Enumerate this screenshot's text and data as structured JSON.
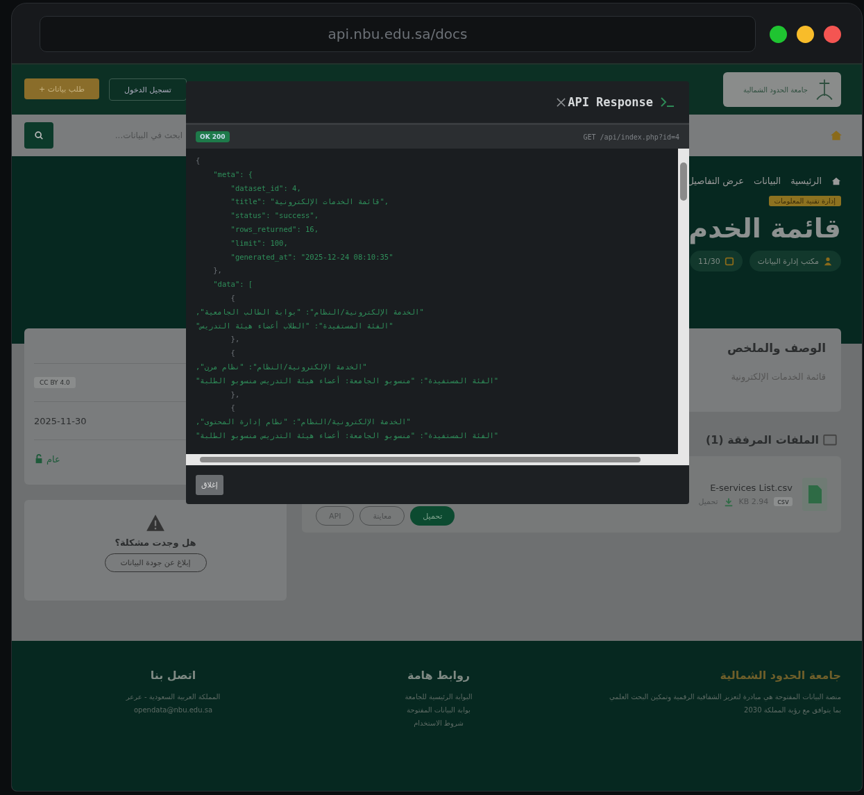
{
  "browser": {
    "address": "api.nbu.edu.sa/docs"
  },
  "header": {
    "logo_text": "جامعة الحدود الشمالية",
    "request_button": "طلب بيانات +",
    "login_button": "تسجيل الدخول"
  },
  "search": {
    "placeholder": "ابحث في البيانات..."
  },
  "breadcrumb": [
    "الرئيسية",
    "البيانات",
    "عرض التفاصيل"
  ],
  "hero": {
    "badge": "إدارة تقنية المعلومات",
    "title": "قائمة الخدم",
    "chips": [
      {
        "kind": "owner",
        "text": "مكتب إدارة البيانات"
      },
      {
        "kind": "date",
        "text": "11/30"
      }
    ]
  },
  "description": {
    "title": "الوصف والملخص",
    "text": "قائمة الخدمات الإلكترونية"
  },
  "files": {
    "title": "الملفات المرفقة (1)",
    "items": [
      {
        "name": "E-services List.csv",
        "format": "csv",
        "size": "2.94 KB",
        "downloads": "تحميل"
      }
    ],
    "actions": [
      {
        "kind": "primary",
        "label": "تحميل"
      },
      {
        "kind": "outline",
        "label": "معاينة"
      },
      {
        "kind": "outline",
        "label": "API"
      }
    ]
  },
  "meta_rows": [
    {
      "kind": "badge",
      "text": "CC BY 4.0"
    },
    {
      "kind": "plain",
      "text": "2025-11-30"
    },
    {
      "kind": "access",
      "text": "عام"
    }
  ],
  "problem": {
    "title": "هل وجدت مشكلة؟",
    "button": "إبلاغ عن جودة البيانات"
  },
  "footer": {
    "columns": [
      {
        "title": "جامعة الحدود الشمالية",
        "kind": "about",
        "lines": [
          "منصة البيانات المفتوحة هي مبادرة لتعزيز الشفافية الرقمية وتمكين البحث العلمي",
          "بما يتوافق مع رؤية المملكة 2030"
        ]
      },
      {
        "title": "روابط هامة",
        "kind": "links",
        "lines": [
          "البوابة الرئيسية للجامعة",
          "بوابة البيانات المفتوحة",
          "شروط الاستخدام"
        ]
      },
      {
        "title": "اتصل بنا",
        "kind": "contact",
        "lines": [
          "المملكة العربية السعودية - عرعر",
          "opendata@nbu.edu.sa"
        ]
      }
    ]
  },
  "modal": {
    "title": "API Response",
    "status": "OK 200",
    "request": "GET /api/index.php?id=4",
    "close_button": "إغلاق",
    "code": [
      {
        "kind": "brace",
        "text": "{"
      },
      {
        "kind": "key",
        "text": "    \"meta\": {"
      },
      {
        "kind": "key",
        "text": "        \"dataset_id\": 4,"
      },
      {
        "kind": "key",
        "text": "        \"title\": \"قائمة الخدمات الإلكترونية\","
      },
      {
        "kind": "key",
        "text": "        \"status\": \"success\","
      },
      {
        "kind": "key",
        "text": "        \"rows_returned\": 16,"
      },
      {
        "kind": "key",
        "text": "        \"limit\": 100,"
      },
      {
        "kind": "key",
        "text": "        \"generated_at\": \"2025-12-24 08:10:35\""
      },
      {
        "kind": "brace",
        "text": "    },"
      },
      {
        "kind": "key",
        "text": "    \"data\": ["
      },
      {
        "kind": "brace",
        "text": "        {"
      },
      {
        "kind": "key",
        "text": "            \"الخدمة الإلكترونية/النظام\": \"بوابة الطالب الجامعية\","
      },
      {
        "kind": "key",
        "text": "            \"الفئة المستفيدة\": \"الطلاب أعضاء هيئة التدريس\""
      },
      {
        "kind": "brace",
        "text": "        },"
      },
      {
        "kind": "brace",
        "text": "        {"
      },
      {
        "kind": "key",
        "text": "            \"الخدمة الإلكترونية/النظام\": \"نظام مرن\","
      },
      {
        "kind": "key",
        "text": "            \"الفئة المستفيدة\": \"منسوبو الجامعة: أعضاء هيئة التدريس منسوبو الطلبة\""
      },
      {
        "kind": "brace",
        "text": "        },"
      },
      {
        "kind": "brace",
        "text": "        {"
      },
      {
        "kind": "key",
        "text": "            \"الخدمة الإلكترونية/النظام\": \"نظام إدارة المحتوى\","
      },
      {
        "kind": "key",
        "text": "            \"الفئة المستفيدة\": \"منسوبو الجامعة: أعضاء هيئة التدريس منسوبو الطلبة\""
      }
    ]
  }
}
